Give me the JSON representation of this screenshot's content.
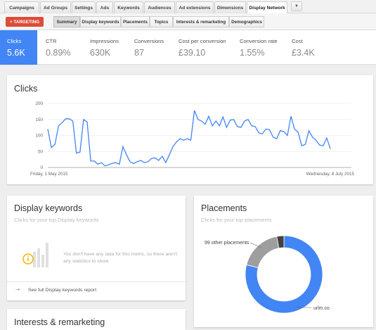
{
  "tabs": [
    "Campaigns",
    "Ad Groups",
    "Settings",
    "Ads",
    "Keywords",
    "Audiences",
    "Ad extensions",
    "Dimensions",
    "Display Network"
  ],
  "tab_more_icon": "dropdown-arrow-icon",
  "toolbar": {
    "targeting_label": "+ TARGETING",
    "subtabs": [
      "Summary",
      "Display keywords",
      "Placements",
      "Topics",
      "Interests & remarketing",
      "Demographics"
    ]
  },
  "metrics": [
    {
      "label": "Clicks",
      "value": "5.6K"
    },
    {
      "label": "CTR",
      "value": "0.89%"
    },
    {
      "label": "Impressions",
      "value": "630K"
    },
    {
      "label": "Conversions",
      "value": "87"
    },
    {
      "label": "Cost per conversion",
      "value": "£39.10"
    },
    {
      "label": "Conversion rate",
      "value": "1.55%"
    },
    {
      "label": "Cost",
      "value": "£3.4K"
    }
  ],
  "clicks_card": {
    "title": "Clicks"
  },
  "chart_data": {
    "type": "line",
    "title": "Clicks",
    "x_start_label": "Friday, 1 May 2015",
    "x_end_label": "Wednesday, 8 July 2015",
    "yticks": [
      "0",
      "50",
      "100",
      "150",
      "200"
    ],
    "ylim": [
      0,
      200
    ],
    "grid": true,
    "series": [
      {
        "values": [
          120,
          62,
          72,
          130,
          140,
          152,
          152,
          145,
          45,
          48,
          150,
          142,
          20,
          20,
          10,
          15,
          5,
          8,
          13,
          15,
          10,
          65,
          40,
          18,
          12,
          18,
          22,
          15,
          18,
          28,
          30,
          22,
          35,
          15,
          40,
          65,
          80,
          90,
          85,
          90,
          85,
          178,
          150,
          145,
          135,
          160,
          130,
          145,
          130,
          158,
          125,
          148,
          150,
          128,
          125,
          145,
          150,
          130,
          128,
          108,
          105,
          120,
          118,
          95,
          90,
          115,
          112,
          100,
          160,
          120,
          110,
          68,
          72,
          115,
          95,
          85,
          70,
          68,
          92,
          58
        ]
      }
    ]
  },
  "display_keywords_card": {
    "title": "Display keywords",
    "subtitle": "Clicks for your top Display keywords",
    "empty_message": "You don't have any data for this metric, so there aren't any statistics to show.",
    "info_icon": "info-icon",
    "footer_link": "See full Display keywords report"
  },
  "placements_card": {
    "title": "Placements",
    "subtitle": "Clicks for your top placements",
    "label_other": "99 other placements",
    "label_main": "urlm.co",
    "colors": {
      "main": "#4285f4",
      "other": "#9e9e9e",
      "third": "#424242"
    }
  },
  "pie_data": {
    "type": "pie",
    "slices": [
      {
        "name": "urlm.co",
        "value": 79
      },
      {
        "name": "99 other placements",
        "value": 18
      },
      {
        "name": "",
        "value": 3
      }
    ]
  },
  "interests_card": {
    "title": "Interests & remarketing"
  },
  "colors": {
    "accent": "#4285f4",
    "targeting": "#dd4b39"
  }
}
